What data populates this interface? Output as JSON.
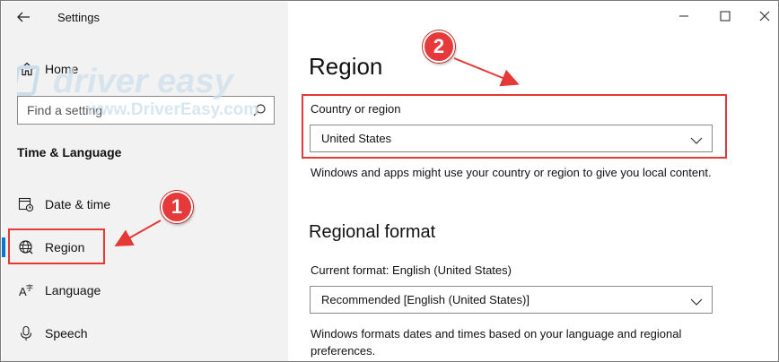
{
  "window": {
    "title": "Settings",
    "controls": [
      "minimize",
      "maximize",
      "close"
    ]
  },
  "sidebar": {
    "home_label": "Home",
    "search_placeholder": "Find a setting",
    "section_title": "Time & Language",
    "items": [
      {
        "label": "Date & time",
        "icon": "calendar-clock-icon",
        "active": false
      },
      {
        "label": "Region",
        "icon": "globe-icon",
        "active": true
      },
      {
        "label": "Language",
        "icon": "language-icon",
        "active": false
      },
      {
        "label": "Speech",
        "icon": "microphone-icon",
        "active": false
      }
    ]
  },
  "watermark": {
    "brand": "driver easy",
    "url": "www.DriverEasy.com"
  },
  "main": {
    "title": "Region",
    "country": {
      "label": "Country or region",
      "value": "United States",
      "description": "Windows and apps might use your country or region to give you local content."
    },
    "regional_format": {
      "title": "Regional format",
      "current_label": "Current format: English (United States)",
      "value": "Recommended [English (United States)]",
      "description": "Windows formats dates and times based on your language and regional preferences."
    }
  },
  "annotations": {
    "step1": "1",
    "step2": "2",
    "color": "#e53935"
  },
  "colors": {
    "accent": "#0078d4",
    "sidebar_bg": "#f2f2f2"
  }
}
